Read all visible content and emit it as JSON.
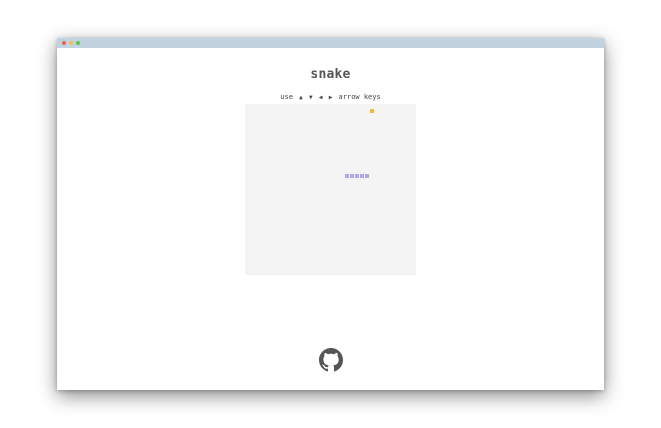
{
  "window": {
    "titlebar_color": "#c3d2df",
    "buttons": [
      {
        "name": "close",
        "color": "#ee5f57"
      },
      {
        "name": "minimize",
        "color": "#f5bd4f"
      },
      {
        "name": "maximize",
        "color": "#5ac84a"
      }
    ]
  },
  "game": {
    "title": "snake",
    "instructions": {
      "prefix": "use",
      "keys": [
        "▲",
        "▼",
        "◀",
        "▶"
      ],
      "suffix": "arrow keys"
    },
    "board": {
      "background": "#f4f4f4",
      "cell_size_units": 1,
      "grid_cols": 34,
      "grid_rows": 34
    },
    "food": {
      "col": 25,
      "row": 1,
      "color": "#f5b93a"
    },
    "snake": {
      "color": "#b7a6e6",
      "segments": [
        {
          "col": 20,
          "row": 14
        },
        {
          "col": 21,
          "row": 14
        },
        {
          "col": 22,
          "row": 14
        },
        {
          "col": 23,
          "row": 14
        },
        {
          "col": 24,
          "row": 14
        }
      ]
    }
  },
  "footer": {
    "icon": "github-icon",
    "color": "#555555"
  }
}
